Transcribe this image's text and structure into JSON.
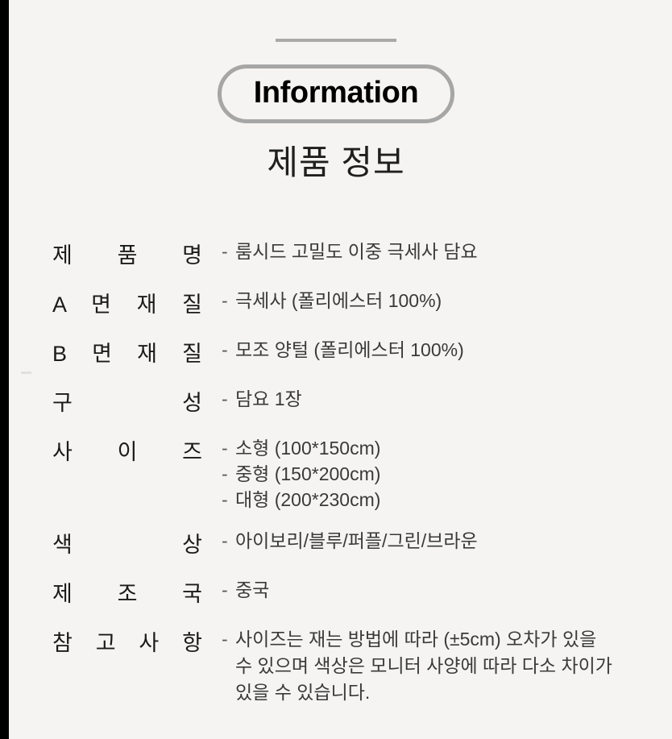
{
  "header": {
    "badge_label": "Information",
    "subtitle": "제품 정보"
  },
  "spec": {
    "rows": [
      {
        "label": "제 품 명",
        "values": [
          "룸시드 고밀도 이중 극세사 담요"
        ]
      },
      {
        "label": "A 면 재 질",
        "values": [
          "극세사 (폴리에스터 100%)"
        ]
      },
      {
        "label": "B 면 재 질",
        "values": [
          "모조 양털 (폴리에스터 100%)"
        ]
      },
      {
        "label": "구 성",
        "values": [
          "담요 1장"
        ]
      },
      {
        "label": "사 이 즈",
        "values": [
          "소형 (100*150cm)",
          "중형 (150*200cm)",
          "대형 (200*230cm)"
        ]
      },
      {
        "label": "색 상",
        "values": [
          "아이보리/블루/퍼플/그린/브라운"
        ]
      },
      {
        "label": "제 조 국",
        "values": [
          "중국"
        ]
      },
      {
        "label": "참 고 사 항",
        "values": [
          "사이즈는 재는 방법에 따라 (±5cm) 오차가 있을 수 있으며 색상은 모니터 사양에 따라 다소 차이가 있을 수 있습니다."
        ]
      }
    ],
    "dash": "-"
  },
  "colors": {
    "background": "#f5f4f2",
    "edge_bar": "#000000",
    "rule": "#a9a9a9",
    "badge_border": "#a6a6a6",
    "label_text": "#1a1a1a",
    "value_text": "#3a3a3a"
  }
}
